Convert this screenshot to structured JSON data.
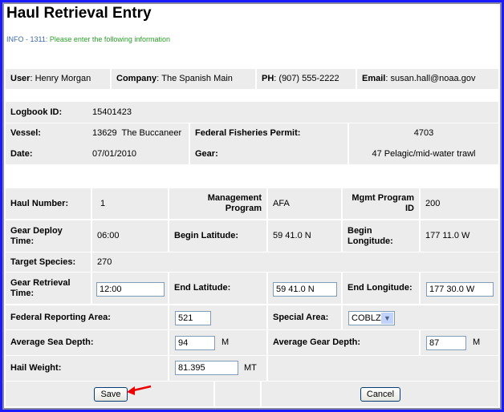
{
  "title": "Haul Retrieval Entry",
  "info": {
    "code": "INFO - 1311:",
    "message": "Please enter the following information"
  },
  "user": {
    "user_label": "User",
    "user": "Henry Morgan",
    "company_label": "Company",
    "company": "The Spanish Main",
    "ph_label": "PH",
    "ph": "(907) 555-2222",
    "email_label": "Email",
    "email": "susan.hall@noaa.gov"
  },
  "logbook": {
    "id_label": "Logbook ID:",
    "id": "15401423",
    "vessel_label": "Vessel:",
    "vessel": "13629  The Buccaneer",
    "permit_label": "Federal Fisheries Permit:",
    "permit": "4703",
    "date_label": "Date:",
    "date": "07/01/2010",
    "gear_label": "Gear:",
    "gear": "47 Pelagic/mid-water trawl"
  },
  "haul": {
    "haul_number_label": "Haul Number:",
    "haul_number": "1",
    "mgmt_program_label": "Management Program",
    "mgmt_program": "AFA",
    "mgmt_program_id_label": "Mgmt Program ID",
    "mgmt_program_id": "200",
    "deploy_time_label": "Gear Deploy Time:",
    "deploy_time": "06:00",
    "begin_lat_label": "Begin Latitude:",
    "begin_lat": "59 41.0 N",
    "begin_lon_label": "Begin Longitude:",
    "begin_lon": "177 11.0 W",
    "target_species_label": "Target Species:",
    "target_species": "270",
    "retrieval_time_label": "Gear Retrieval Time:",
    "retrieval_time": "12:00",
    "end_lat_label": "End Latitude:",
    "end_lat": "59 41.0 N",
    "end_lon_label": "End Longitude:",
    "end_lon": "177 30.0 W",
    "fed_area_label": "Federal Reporting Area:",
    "fed_area": "521",
    "special_area_label": "Special Area:",
    "special_area": "COBLZ",
    "sea_depth_label": "Average Sea Depth:",
    "sea_depth": "94",
    "sea_depth_unit": "M",
    "gear_depth_label": "Average Gear Depth:",
    "gear_depth": "87",
    "gear_depth_unit": "M",
    "hail_weight_label": "Hail Weight:",
    "hail_weight": "81.395",
    "hail_weight_unit": "MT"
  },
  "buttons": {
    "save": "Save",
    "cancel": "Cancel"
  }
}
